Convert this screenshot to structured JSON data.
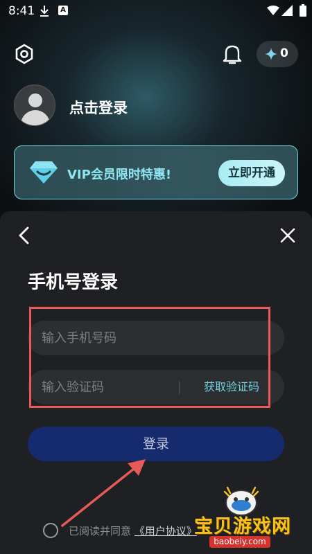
{
  "status_bar": {
    "time": "8:41",
    "notification_letter": "A"
  },
  "header": {
    "points_count": "0"
  },
  "profile": {
    "login_prompt": "点击登录"
  },
  "vip_banner": {
    "text": "VIP会员限时特惠!",
    "button_label": "立即开通"
  },
  "login_sheet": {
    "title": "手机号登录",
    "phone_placeholder": "输入手机号码",
    "code_placeholder": "输入验证码",
    "get_code_label": "获取验证码",
    "login_button_label": "登录",
    "agreement_prefix": "已阅读并同意",
    "agreement_link": "《用户协议》"
  },
  "watermark": {
    "brand": "宝贝游戏网",
    "url": "baobeiy.com"
  },
  "colors": {
    "accent": "#6fd4e0",
    "login_button": "#162a6e",
    "annotation_red": "#e85a5a",
    "sheet_background": "#1e2023",
    "watermark_gold": "#f7c21b"
  },
  "icons": [
    "download-icon",
    "notification-a-icon",
    "wifi-icon",
    "signal-icon",
    "battery-icon",
    "settings-icon",
    "bell-icon",
    "spark-icon",
    "avatar-icon",
    "diamond-icon",
    "back-icon",
    "close-icon"
  ]
}
